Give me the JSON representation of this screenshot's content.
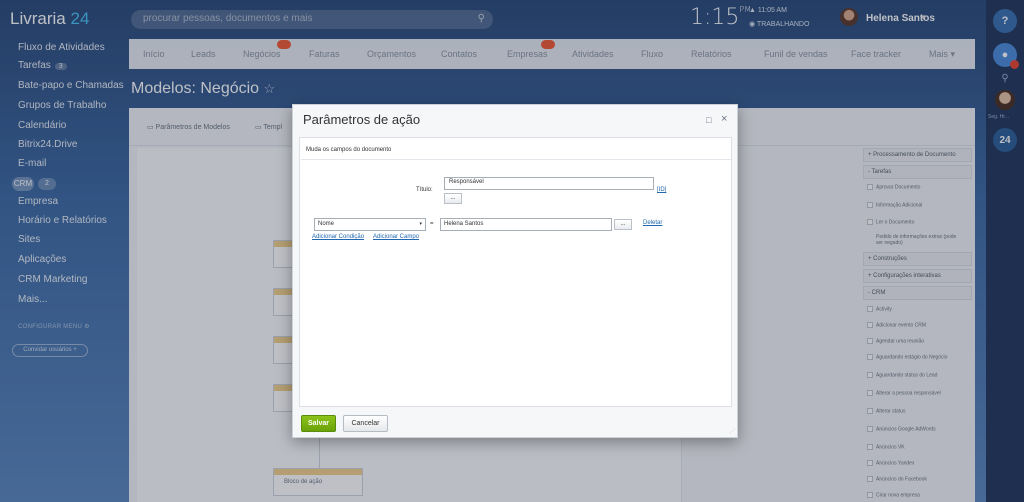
{
  "header": {
    "logo_text": "Livraria",
    "logo_num": "24",
    "search_placeholder": "procurar pessoas, documentos e mais",
    "time": "1:15",
    "time_suffix": "PM",
    "alarm": "▲ 11:05 AM",
    "work_status": "◉ TRABALHANDO",
    "user_name": "Helena Santos",
    "user_caret": "▾"
  },
  "right_bar": {
    "help": "?",
    "label": "Seg. Hr...",
    "b24": "24"
  },
  "left_menu": {
    "items": [
      "Fluxo de Atividades",
      "Tarefas",
      "Bate-papo e Chamadas",
      "Grupos de Trabalho",
      "Calendário",
      "Bitrix24.Drive",
      "E-mail",
      "Empresa",
      "Horário e Relatórios",
      "Sites",
      "Aplicações",
      "CRM Marketing",
      "Mais..."
    ],
    "tarefas_badge": "3",
    "crm": "CRM",
    "crm_badge": "2",
    "config_label": "CONFIGURAR MENU ⚙",
    "invite_label": "Convidar usuários +"
  },
  "nav": {
    "items": [
      "Início",
      "Leads",
      "Negócios",
      "Faturas",
      "Orçamentos",
      "Contatos",
      "Empresas",
      "Atividades",
      "Fluxo",
      "Relatórios",
      "Funil de vendas",
      "Face tracker",
      "Mais ▾"
    ]
  },
  "page": {
    "title": "Modelos: Negócio",
    "star": "☆"
  },
  "panel": {
    "tab1": "▭ Parâmetros de Modelos",
    "tab2": "▭ Templ",
    "block_label": "Bloco de ação"
  },
  "actions_panel": {
    "headers": [
      "+ Processamento de Documento",
      "- Tarefas",
      "+ Construções",
      "+ Configurações interativas",
      "- CRM"
    ],
    "tarefas_items": [
      "Aprovar Documento",
      "Informação Adicional",
      "Ler o Documento",
      "Pedido de informações extras (pode ser negado)"
    ],
    "crm_items": [
      "Activity",
      "Adicionar evento CRM",
      "Agendar uma reunião",
      "Aguardando estágio do Negócio",
      "Aguardando status do Lead",
      "Alterar a pessoa responsável",
      "Alterar status",
      "Anúncios Google AdWords",
      "Anúncios VK",
      "Anúncios Yandex",
      "Anúncios do Facebook",
      "Criar nova empresa"
    ]
  },
  "modal": {
    "title": "Parâmetros de ação",
    "restore_icon": "□",
    "close_icon": "×",
    "caption": "Muda os campos do documento",
    "title_label": "Título:",
    "title_value": "Responsável",
    "dots": "...",
    "id_link": "[ID]",
    "field_select": "Nome",
    "select_caret": "▾",
    "equals": "=",
    "field_value": "Helena Santos",
    "delete_link": "Deletar",
    "add_condition": "Adicionar Condição",
    "add_field": "Adicionar Campo",
    "save": "Salvar",
    "cancel": "Cancelar"
  }
}
